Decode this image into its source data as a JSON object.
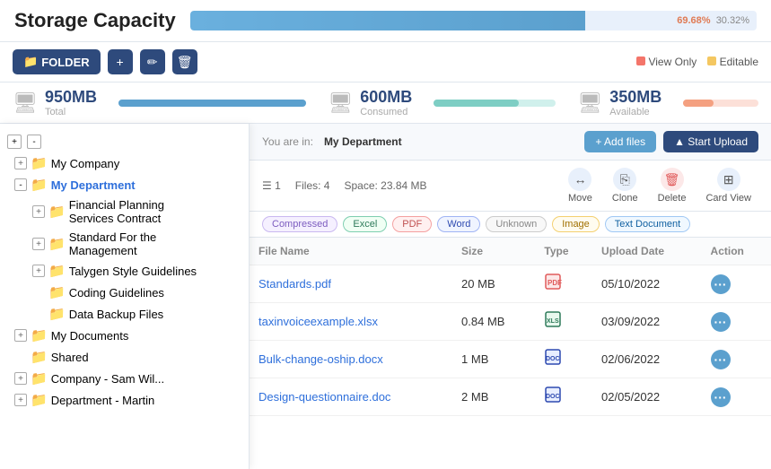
{
  "header": {
    "title": "Storage Capacity",
    "capacity_used_pct": "69.68%",
    "capacity_avail_pct": "30.32%"
  },
  "toolbar": {
    "folder_label": "FOLDER",
    "view_only_label": "View Only",
    "editable_label": "Editable"
  },
  "stats": {
    "total_val": "950MB",
    "total_label": "Total",
    "consumed_val": "600MB",
    "consumed_label": "Consumed",
    "available_val": "350MB",
    "available_label": "Available"
  },
  "content": {
    "breadcrumb_prefix": "You are in:",
    "breadcrumb_location": "My Department",
    "add_files_label": "+ Add files",
    "start_upload_label": "▲ Start Upload",
    "folder_num": "1",
    "files_count": "Files: 4",
    "space_used": "Space: 23.84 MB"
  },
  "action_buttons": {
    "move_label": "Move",
    "clone_label": "Clone",
    "delete_label": "Delete",
    "card_view_label": "Card View"
  },
  "filters": [
    {
      "label": "Compressed",
      "type": "compressed"
    },
    {
      "label": "Excel",
      "type": "excel"
    },
    {
      "label": "PDF",
      "type": "pdf"
    },
    {
      "label": "Word",
      "type": "word"
    },
    {
      "label": "Unknown",
      "type": "unknown"
    },
    {
      "label": "Image",
      "type": "image"
    },
    {
      "label": "Text Document",
      "type": "textdoc"
    }
  ],
  "table": {
    "col_filename": "File Name",
    "col_size": "Size",
    "col_type": "Type",
    "col_upload_date": "Upload Date",
    "col_action": "Action",
    "rows": [
      {
        "name": "Standards.pdf",
        "size": "20 MB",
        "type": "pdf",
        "date": "05/10/2022"
      },
      {
        "name": "taxinvoiceexample.xlsx",
        "size": "0.84 MB",
        "type": "xlsx",
        "date": "03/09/2022"
      },
      {
        "name": "Bulk-change-oship.docx",
        "size": "1 MB",
        "type": "docx",
        "date": "02/06/2022"
      },
      {
        "name": "Design-questionnaire.doc",
        "size": "2 MB",
        "type": "docx",
        "date": "02/05/2022"
      }
    ]
  },
  "tree": [
    {
      "level": 1,
      "toggle": "+",
      "folder_color": "blue",
      "label": "My Company",
      "active": false
    },
    {
      "level": 1,
      "toggle": "-",
      "folder_color": "blue",
      "label": "My Department",
      "active": true
    },
    {
      "level": 2,
      "toggle": "+",
      "folder_color": "red",
      "label": "Financial Planning Services Contract",
      "active": false
    },
    {
      "level": 2,
      "toggle": "+",
      "folder_color": "red",
      "label": "Standard For the Management",
      "active": false
    },
    {
      "level": 2,
      "toggle": "+",
      "folder_color": "red",
      "label": "Talygen Style Guidelines",
      "active": false
    },
    {
      "level": 2,
      "toggle": null,
      "folder_color": "red",
      "label": "Coding Guidelines",
      "active": false
    },
    {
      "level": 2,
      "toggle": null,
      "folder_color": "red",
      "label": "Data Backup Files",
      "active": false
    },
    {
      "level": 1,
      "toggle": "+",
      "folder_color": "blue",
      "label": "My Documents",
      "active": false
    },
    {
      "level": 1,
      "toggle": null,
      "folder_color": "yellow",
      "label": "Shared",
      "active": false
    },
    {
      "level": 1,
      "toggle": "+",
      "folder_color": "blue",
      "label": "Company - Sam Wil...",
      "active": false
    },
    {
      "level": 1,
      "toggle": "+",
      "folder_color": "blue",
      "label": "Department - Martin",
      "active": false
    }
  ]
}
